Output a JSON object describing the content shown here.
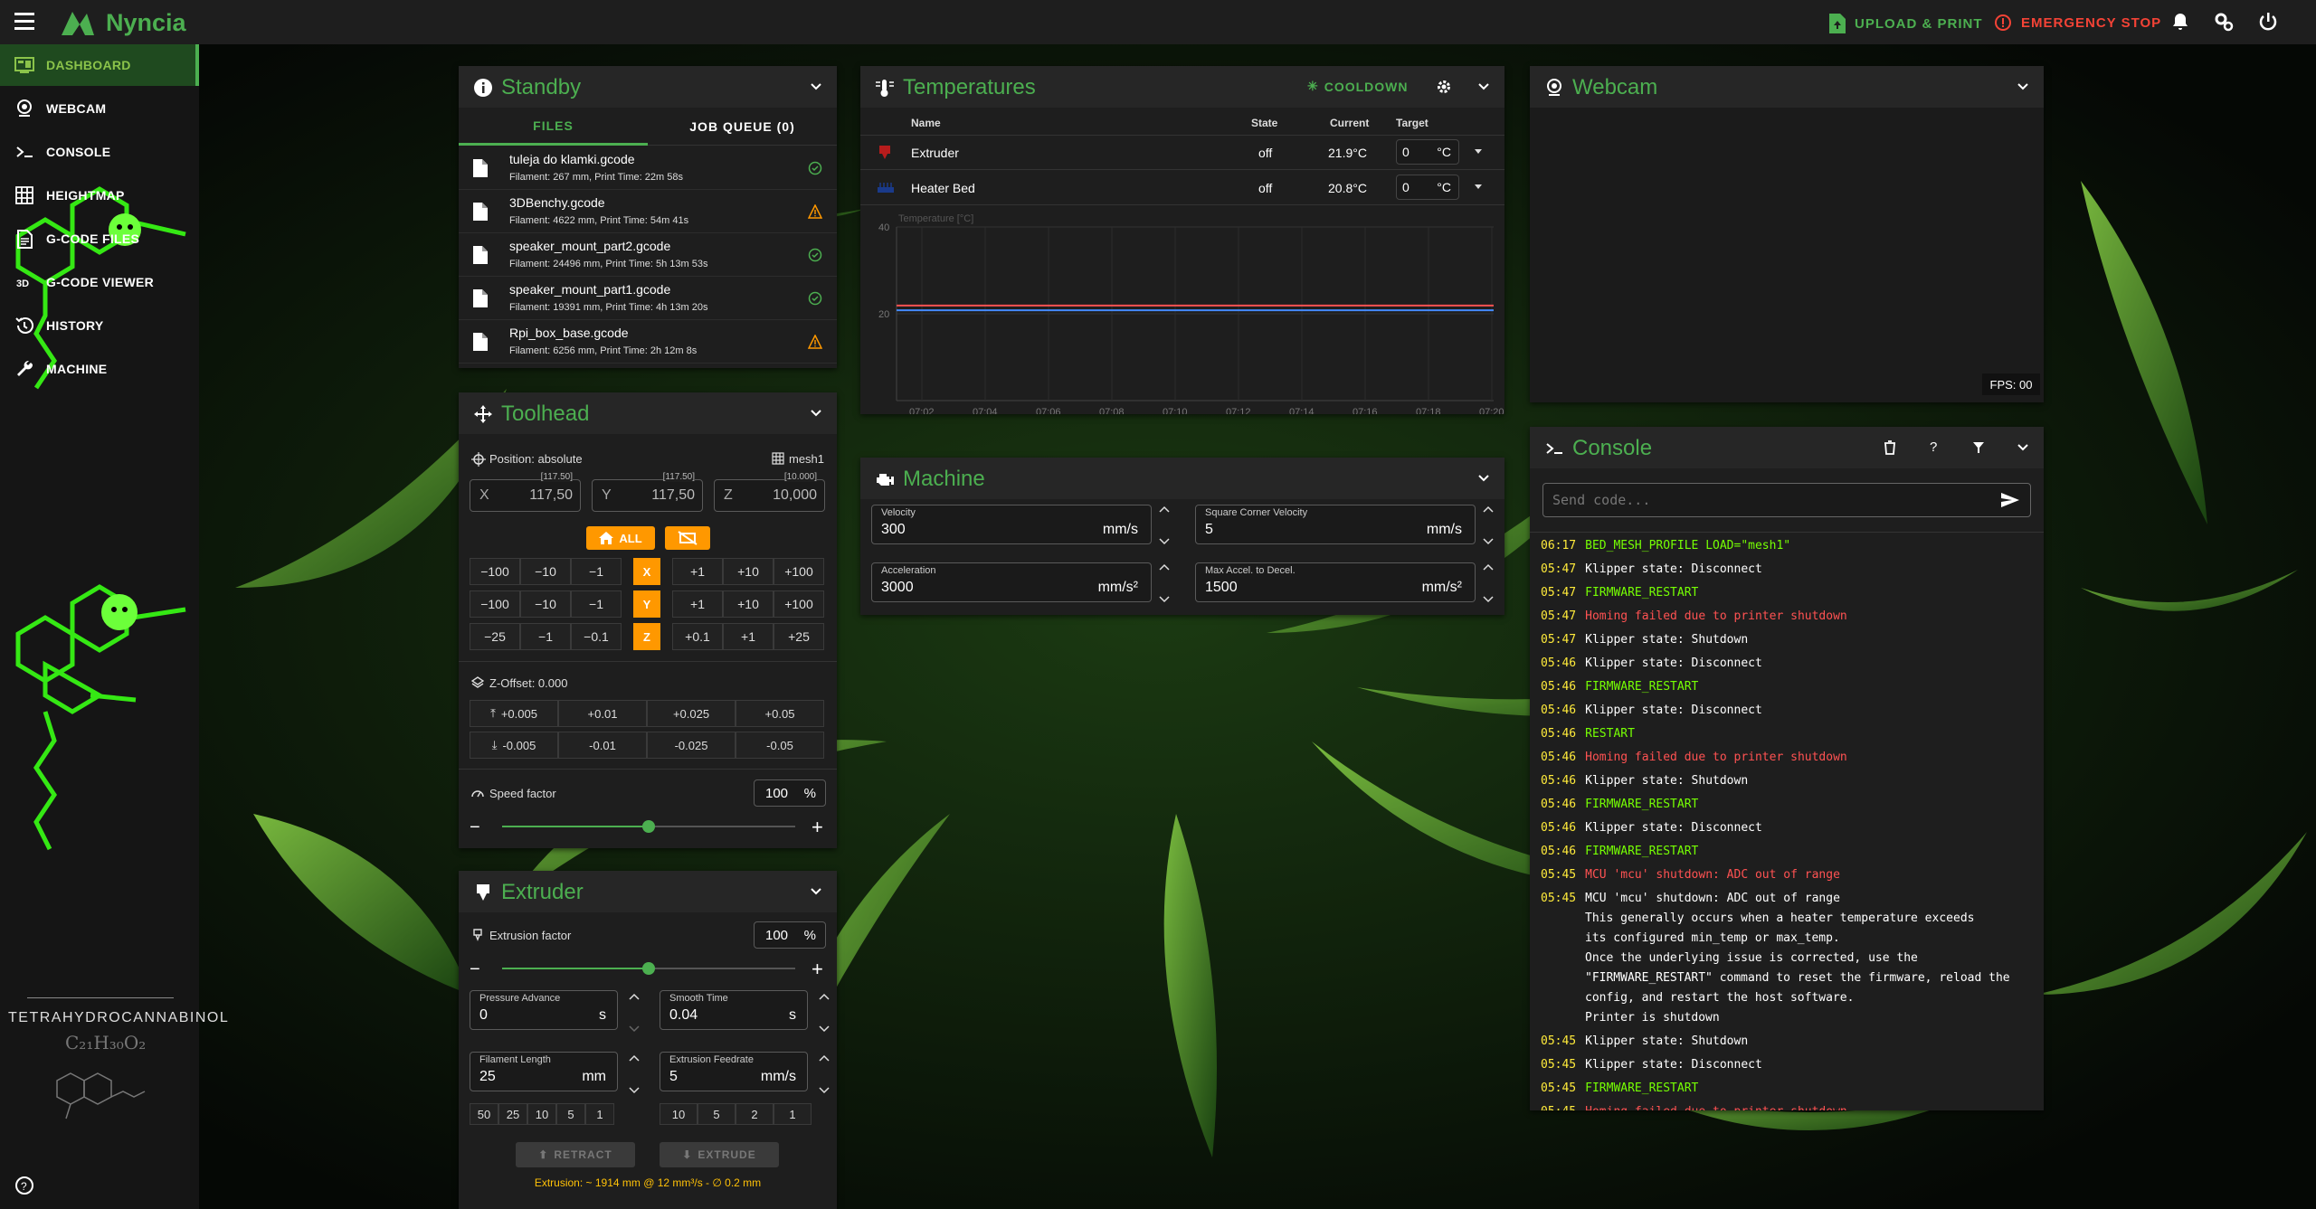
{
  "app": {
    "name": "Nyncia",
    "upload_label": "UPLOAD & PRINT",
    "estop_label": "EMERGENCY STOP",
    "accent": "#4caf50"
  },
  "sidebar": {
    "items": [
      {
        "label": "DASHBOARD",
        "icon": "monitor-dashboard-icon"
      },
      {
        "label": "WEBCAM",
        "icon": "webcam-icon"
      },
      {
        "label": "CONSOLE",
        "icon": "console-icon"
      },
      {
        "label": "HEIGHTMAP",
        "icon": "grid-icon"
      },
      {
        "label": "G-CODE FILES",
        "icon": "file-document-icon"
      },
      {
        "label": "G-CODE VIEWER",
        "icon": "3d-icon"
      },
      {
        "label": "HISTORY",
        "icon": "history-icon"
      },
      {
        "label": "MACHINE",
        "icon": "wrench-icon"
      }
    ],
    "thc_title": "TETRAHYDROCANNABINOL",
    "thc_formula": "C₂₁H₃₀O₂"
  },
  "standby": {
    "title": "Standby",
    "tab_files": "FILES",
    "tab_queue": "JOB QUEUE (0)",
    "files": [
      {
        "name": "tuleja do klamki.gcode",
        "meta": "Filament: 267 mm, Print Time: 22m 58s",
        "status": "ok"
      },
      {
        "name": "3DBenchy.gcode",
        "meta": "Filament: 4622 mm, Print Time: 54m 41s",
        "status": "warn"
      },
      {
        "name": "speaker_mount_part2.gcode",
        "meta": "Filament: 24496 mm, Print Time: 5h 13m 53s",
        "status": "ok"
      },
      {
        "name": "speaker_mount_part1.gcode",
        "meta": "Filament: 19391 mm, Print Time: 4h 13m 20s",
        "status": "ok"
      },
      {
        "name": "Rpi_box_base.gcode",
        "meta": "Filament: 6256 mm, Print Time: 2h 12m 8s",
        "status": "warn"
      }
    ]
  },
  "toolhead": {
    "title": "Toolhead",
    "position_label": "Position: absolute",
    "mesh_label": "mesh1",
    "x": {
      "label": "X",
      "value": "117,50",
      "raw": "[117.50]"
    },
    "y": {
      "label": "Y",
      "value": "117,50",
      "raw": "[117.50]"
    },
    "z": {
      "label": "Z",
      "value": "10,000",
      "raw": "[10.000]"
    },
    "home_all": "ALL",
    "x_row": [
      "−100",
      "−10",
      "−1",
      "X",
      "+1",
      "+10",
      "+100"
    ],
    "y_row": [
      "−100",
      "−10",
      "−1",
      "Y",
      "+1",
      "+10",
      "+100"
    ],
    "z_row": [
      "−25",
      "−1",
      "−0.1",
      "Z",
      "+0.1",
      "+1",
      "+25"
    ],
    "zoffset_label": "Z-Offset: 0.000",
    "zoff_up": [
      "+0.005",
      "+0.01",
      "+0.025",
      "+0.05"
    ],
    "zoff_down": [
      "-0.005",
      "-0.01",
      "-0.025",
      "-0.05"
    ],
    "speed_label": "Speed factor",
    "speed_value": "100",
    "speed_unit": "%",
    "speed_fraction": 0.5
  },
  "extruder": {
    "title": "Extruder",
    "factor_label": "Extrusion factor",
    "factor_value": "100",
    "factor_unit": "%",
    "factor_fraction": 0.5,
    "pa_label": "Pressure Advance",
    "pa_value": "0",
    "pa_unit": "s",
    "st_label": "Smooth Time",
    "st_value": "0.04",
    "st_unit": "s",
    "fl_label": "Filament Length",
    "fl_value": "25",
    "fl_unit": "mm",
    "ef_label": "Extrusion Feedrate",
    "ef_value": "5",
    "ef_unit": "mm/s",
    "len_presets": [
      "50",
      "25",
      "10",
      "5",
      "1"
    ],
    "feed_presets": [
      "10",
      "5",
      "2",
      "1"
    ],
    "retract_label": "RETRACT",
    "extrude_label": "EXTRUDE",
    "summary": "Extrusion: ~ 1914 mm @ 12 mm³/s - ∅ 0.2 mm"
  },
  "temperatures": {
    "title": "Temperatures",
    "cooldown": "COOLDOWN",
    "headers": {
      "name": "Name",
      "state": "State",
      "current": "Current",
      "target": "Target"
    },
    "rows": [
      {
        "name": "Extruder",
        "state": "off",
        "current": "21.9°C",
        "target": "0",
        "unit": "°C",
        "color": "#ff5252"
      },
      {
        "name": "Heater Bed",
        "state": "off",
        "current": "20.8°C",
        "target": "0",
        "unit": "°C",
        "color": "#448aff"
      }
    ]
  },
  "chart_data": {
    "type": "line",
    "ylabel": "Temperature [°C]",
    "ytick_labels": [
      "40",
      "20"
    ],
    "ylim": [
      0,
      40
    ],
    "categories": [
      "07:02",
      "07:04",
      "07:06",
      "07:08",
      "07:10",
      "07:12",
      "07:14",
      "07:16",
      "07:18",
      "07:20"
    ],
    "series": [
      {
        "name": "Extruder",
        "color": "#ff5252",
        "values": [
          21.9,
          21.9,
          21.9,
          21.9,
          21.9,
          21.9,
          21.9,
          21.9,
          21.9,
          21.9
        ]
      },
      {
        "name": "Heater Bed",
        "color": "#448aff",
        "values": [
          20.8,
          20.8,
          20.8,
          20.8,
          20.8,
          20.8,
          20.8,
          20.8,
          20.8,
          20.8
        ]
      }
    ]
  },
  "machine": {
    "title": "Machine",
    "velocity_label": "Velocity",
    "velocity_value": "300",
    "velocity_unit": "mm/s",
    "scv_label": "Square Corner Velocity",
    "scv_value": "5",
    "scv_unit": "mm/s",
    "accel_label": "Acceleration",
    "accel_value": "3000",
    "accel_unit": "mm/s²",
    "decel_label": "Max Accel. to Decel.",
    "decel_value": "1500",
    "decel_unit": "mm/s²"
  },
  "webcam": {
    "title": "Webcam",
    "fps": "FPS: 00"
  },
  "console": {
    "title": "Console",
    "placeholder": "Send code...",
    "lines": [
      {
        "t": "06:17",
        "m": "BED_MESH_PROFILE LOAD=\"mesh1\"",
        "c": "#76ff03"
      },
      {
        "t": "05:47",
        "m": "Klipper state: Disconnect",
        "c": "#ffffff"
      },
      {
        "t": "05:47",
        "m": "FIRMWARE_RESTART",
        "c": "#76ff03"
      },
      {
        "t": "05:47",
        "m": "Homing failed due to printer shutdown",
        "c": "#ff5252"
      },
      {
        "t": "05:47",
        "m": "Klipper state: Shutdown",
        "c": "#ffffff"
      },
      {
        "t": "05:46",
        "m": "Klipper state: Disconnect",
        "c": "#ffffff"
      },
      {
        "t": "05:46",
        "m": "FIRMWARE_RESTART",
        "c": "#76ff03"
      },
      {
        "t": "05:46",
        "m": "Klipper state: Disconnect",
        "c": "#ffffff"
      },
      {
        "t": "05:46",
        "m": "RESTART",
        "c": "#76ff03"
      },
      {
        "t": "05:46",
        "m": "Homing failed due to printer shutdown",
        "c": "#ff5252"
      },
      {
        "t": "05:46",
        "m": "Klipper state: Shutdown",
        "c": "#ffffff"
      },
      {
        "t": "05:46",
        "m": "FIRMWARE_RESTART",
        "c": "#76ff03"
      },
      {
        "t": "05:46",
        "m": "Klipper state: Disconnect",
        "c": "#ffffff"
      },
      {
        "t": "05:46",
        "m": "FIRMWARE_RESTART",
        "c": "#76ff03"
      },
      {
        "t": "05:45",
        "m": "MCU 'mcu' shutdown: ADC out of range",
        "c": "#ff5252"
      },
      {
        "t": "05:45",
        "m": "MCU 'mcu' shutdown: ADC out of range",
        "c": "#ffffff"
      }
    ],
    "multiline": [
      "This generally occurs when a heater temperature exceeds",
      "its configured min_temp or max_temp.",
      "Once the underlying issue is corrected, use the",
      "\"FIRMWARE_RESTART\" command to reset the firmware, reload the",
      "config, and restart the host software.",
      "Printer is shutdown"
    ],
    "tail": [
      {
        "t": "05:45",
        "m": "Klipper state: Shutdown",
        "c": "#ffffff"
      },
      {
        "t": "05:45",
        "m": "Klipper state: Disconnect",
        "c": "#ffffff"
      },
      {
        "t": "05:45",
        "m": "FIRMWARE_RESTART",
        "c": "#76ff03"
      },
      {
        "t": "05:45",
        "m": "Homing failed due to printer shutdown",
        "c": "#ff5252"
      }
    ]
  }
}
